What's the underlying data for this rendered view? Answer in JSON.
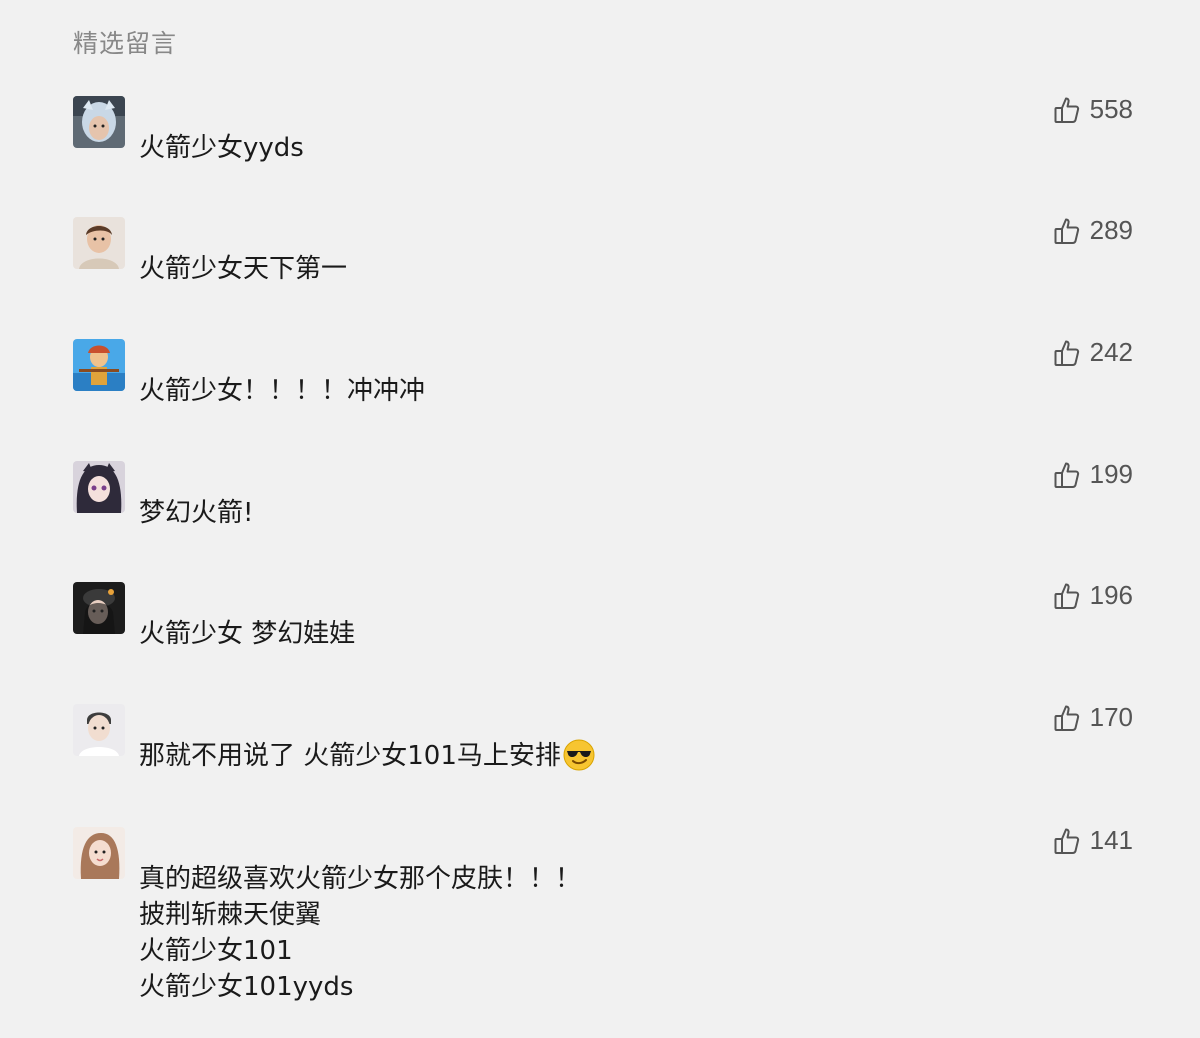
{
  "section": {
    "title": "精选留言"
  },
  "comments": [
    {
      "text": "火箭少女yyds",
      "likes": "558",
      "avatar": "avatar-icon"
    },
    {
      "text": "火箭少女天下第一",
      "likes": "289",
      "avatar": "avatar-icon"
    },
    {
      "text": "火箭少女！！！！冲冲冲",
      "likes": "242",
      "avatar": "avatar-icon"
    },
    {
      "text": "梦幻火箭!",
      "likes": "199",
      "avatar": "avatar-icon"
    },
    {
      "text": "火箭少女 梦幻娃娃",
      "likes": "196",
      "avatar": "avatar-icon"
    },
    {
      "text": "那就不用说了 火箭少女101马上安排",
      "likes": "170",
      "avatar": "avatar-icon",
      "emoji": "sunglasses-emoji-icon"
    },
    {
      "text": "真的超级喜欢火箭少女那个皮肤！！！\n披荆斩棘天使翼\n火箭少女101\n火箭少女101yyds",
      "likes": "141",
      "avatar": "avatar-icon"
    }
  ],
  "icons": {
    "like": "thumbs-up-outline-icon"
  },
  "colors": {
    "background": "#f1f1f1",
    "text": "#1a1a1a",
    "muted": "#888888",
    "like_count": "#555555"
  }
}
